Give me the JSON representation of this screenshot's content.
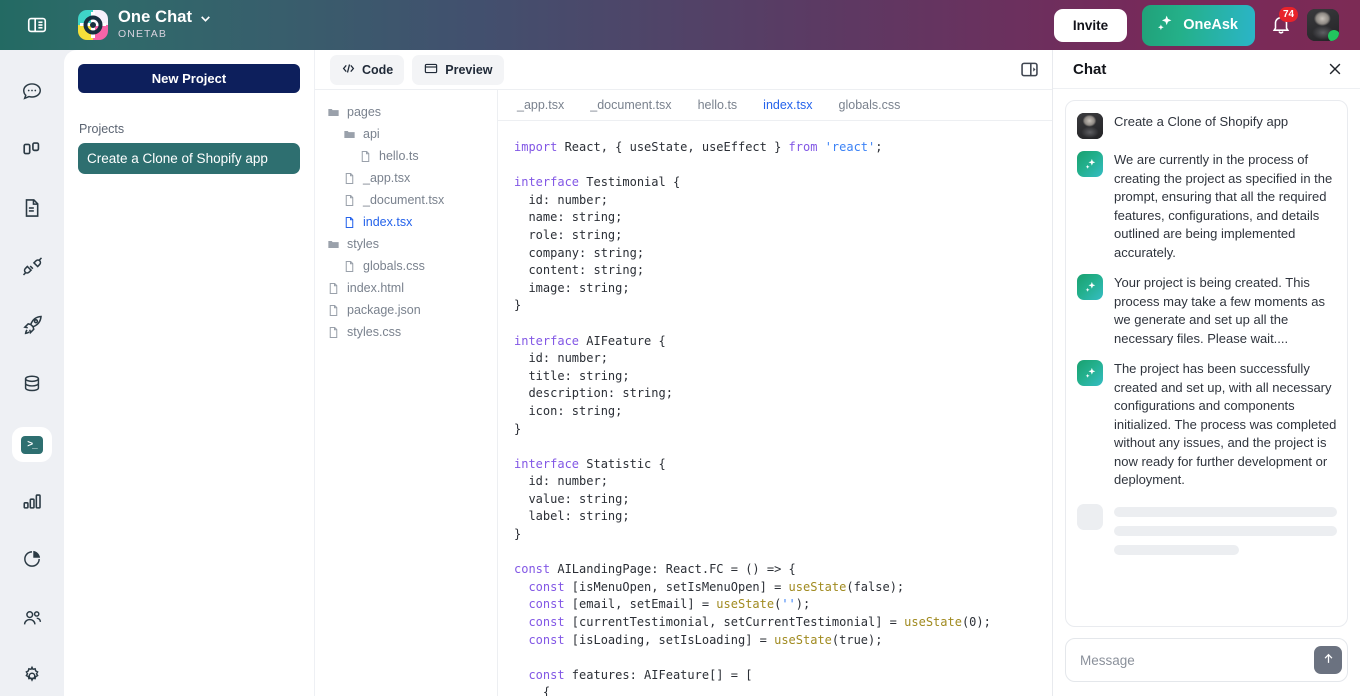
{
  "header": {
    "panel_toggle_icon": "panel-left-icon",
    "logo_icon": "onetab-logo-icon",
    "brand_title": "One Chat",
    "brand_subtitle": "ONETAB",
    "brand_chevron_icon": "chevron-down-icon",
    "invite_label": "Invite",
    "oneask_label": "OneAsk",
    "oneask_icon": "sparkles-icon",
    "bell_icon": "bell-icon",
    "notification_count": "74",
    "avatar_icon": "user-avatar",
    "gradient_start": "#236a63",
    "gradient_mid": "#4a4066",
    "gradient_end": "#7c2b55",
    "accent_teal": "#2e6f70",
    "badge_color": "#e8232b",
    "online_color": "#22c55e"
  },
  "rail": {
    "items": [
      {
        "name": "chat",
        "icon": "chat-bubble-icon",
        "active": false
      },
      {
        "name": "layout",
        "icon": "columns-layout-icon",
        "active": false
      },
      {
        "name": "documents",
        "icon": "document-icon",
        "active": false
      },
      {
        "name": "integrations",
        "icon": "plug-connector-icon",
        "active": false
      },
      {
        "name": "deploy",
        "icon": "rocket-icon",
        "active": false
      },
      {
        "name": "database",
        "icon": "database-icon",
        "active": false
      },
      {
        "name": "terminal",
        "icon": "terminal-icon",
        "active": true
      },
      {
        "name": "analytics",
        "icon": "bar-chart-icon",
        "active": false
      },
      {
        "name": "reports",
        "icon": "pie-chart-icon",
        "active": false
      },
      {
        "name": "team",
        "icon": "users-icon",
        "active": false
      },
      {
        "name": "settings",
        "icon": "gear-icon",
        "active": false
      }
    ]
  },
  "projects": {
    "new_project_label": "New Project",
    "section_label": "Projects",
    "items": [
      {
        "label": "Create a Clone of Shopify app",
        "selected": true
      }
    ]
  },
  "editor": {
    "toolbar": {
      "code_label": "Code",
      "code_icon": "code-brackets-icon",
      "preview_label": "Preview",
      "preview_icon": "window-preview-icon",
      "panel_toggle_icon": "panel-right-icon"
    },
    "filetree": [
      {
        "label": "pages",
        "type": "folder",
        "depth": 0,
        "selected": false
      },
      {
        "label": "api",
        "type": "folder",
        "depth": 1,
        "selected": false
      },
      {
        "label": "hello.ts",
        "type": "file",
        "depth": 2,
        "selected": false
      },
      {
        "label": "_app.tsx",
        "type": "file",
        "depth": 1,
        "selected": false
      },
      {
        "label": "_document.tsx",
        "type": "file",
        "depth": 1,
        "selected": false
      },
      {
        "label": "index.tsx",
        "type": "file",
        "depth": 1,
        "selected": true
      },
      {
        "label": "styles",
        "type": "folder",
        "depth": 0,
        "selected": false
      },
      {
        "label": "globals.css",
        "type": "file",
        "depth": 1,
        "selected": false
      },
      {
        "label": "index.html",
        "type": "file",
        "depth": 0,
        "selected": false
      },
      {
        "label": "package.json",
        "type": "file",
        "depth": 0,
        "selected": false
      },
      {
        "label": "styles.css",
        "type": "file",
        "depth": 0,
        "selected": false
      }
    ],
    "tabs": [
      {
        "label": "_app.tsx",
        "active": false
      },
      {
        "label": "_document.tsx",
        "active": false
      },
      {
        "label": "hello.ts",
        "active": false
      },
      {
        "label": "index.tsx",
        "active": true
      },
      {
        "label": "globals.css",
        "active": false
      }
    ],
    "code_lines": [
      [
        {
          "t": "import",
          "c": "kw"
        },
        {
          "t": " React, { useState, useEffect } ",
          "c": "plain"
        },
        {
          "t": "from",
          "c": "kw"
        },
        {
          "t": " ",
          "c": "plain"
        },
        {
          "t": "'react'",
          "c": "str"
        },
        {
          "t": ";",
          "c": "plain"
        }
      ],
      [],
      [
        {
          "t": "interface",
          "c": "kw"
        },
        {
          "t": " Testimonial {",
          "c": "plain"
        }
      ],
      [
        {
          "t": "  id: number;",
          "c": "plain"
        }
      ],
      [
        {
          "t": "  name: string;",
          "c": "plain"
        }
      ],
      [
        {
          "t": "  role: string;",
          "c": "plain"
        }
      ],
      [
        {
          "t": "  company: string;",
          "c": "plain"
        }
      ],
      [
        {
          "t": "  content: string;",
          "c": "plain"
        }
      ],
      [
        {
          "t": "  image: string;",
          "c": "plain"
        }
      ],
      [
        {
          "t": "}",
          "c": "plain"
        }
      ],
      [],
      [
        {
          "t": "interface",
          "c": "kw"
        },
        {
          "t": " AIFeature {",
          "c": "plain"
        }
      ],
      [
        {
          "t": "  id: number;",
          "c": "plain"
        }
      ],
      [
        {
          "t": "  title: string;",
          "c": "plain"
        }
      ],
      [
        {
          "t": "  description: string;",
          "c": "plain"
        }
      ],
      [
        {
          "t": "  icon: string;",
          "c": "plain"
        }
      ],
      [
        {
          "t": "}",
          "c": "plain"
        }
      ],
      [],
      [
        {
          "t": "interface",
          "c": "kw"
        },
        {
          "t": " Statistic {",
          "c": "plain"
        }
      ],
      [
        {
          "t": "  id: number;",
          "c": "plain"
        }
      ],
      [
        {
          "t": "  value: string;",
          "c": "plain"
        }
      ],
      [
        {
          "t": "  label: string;",
          "c": "plain"
        }
      ],
      [
        {
          "t": "}",
          "c": "plain"
        }
      ],
      [],
      [
        {
          "t": "const",
          "c": "kw"
        },
        {
          "t": " AILandingPage: React.FC = () => {",
          "c": "plain"
        }
      ],
      [
        {
          "t": "  ",
          "c": "plain"
        },
        {
          "t": "const",
          "c": "kw"
        },
        {
          "t": " [isMenuOpen, setIsMenuOpen] = ",
          "c": "plain"
        },
        {
          "t": "useState",
          "c": "fn"
        },
        {
          "t": "(false);",
          "c": "plain"
        }
      ],
      [
        {
          "t": "  ",
          "c": "plain"
        },
        {
          "t": "const",
          "c": "kw"
        },
        {
          "t": " [email, setEmail] = ",
          "c": "plain"
        },
        {
          "t": "useState",
          "c": "fn"
        },
        {
          "t": "(",
          "c": "plain"
        },
        {
          "t": "''",
          "c": "str"
        },
        {
          "t": ");",
          "c": "plain"
        }
      ],
      [
        {
          "t": "  ",
          "c": "plain"
        },
        {
          "t": "const",
          "c": "kw"
        },
        {
          "t": " [currentTestimonial, setCurrentTestimonial] = ",
          "c": "plain"
        },
        {
          "t": "useState",
          "c": "fn"
        },
        {
          "t": "(0);",
          "c": "plain"
        }
      ],
      [
        {
          "t": "  ",
          "c": "plain"
        },
        {
          "t": "const",
          "c": "kw"
        },
        {
          "t": " [isLoading, setIsLoading] = ",
          "c": "plain"
        },
        {
          "t": "useState",
          "c": "fn"
        },
        {
          "t": "(true);",
          "c": "plain"
        }
      ],
      [],
      [
        {
          "t": "  ",
          "c": "plain"
        },
        {
          "t": "const",
          "c": "kw"
        },
        {
          "t": " features: AIFeature[] = [",
          "c": "plain"
        }
      ],
      [
        {
          "t": "    {",
          "c": "plain"
        }
      ]
    ]
  },
  "chat": {
    "title": "Chat",
    "close_icon": "close-icon",
    "messages": [
      {
        "role": "user",
        "avatar_icon": "user-avatar",
        "text": "Create a Clone of Shopify app"
      },
      {
        "role": "ai",
        "avatar_icon": "sparkles-icon",
        "text": "We are currently in the process of creating the project as specified in the prompt, ensuring that all the required features, configurations, and details outlined are being implemented accurately."
      },
      {
        "role": "ai",
        "avatar_icon": "sparkles-icon",
        "text": "Your project is being created. This process may take a few moments as we generate and set up all the necessary files. Please wait...."
      },
      {
        "role": "ai",
        "avatar_icon": "sparkles-icon",
        "text": "The project has been successfully created and set up, with all necessary configurations and components initialized. The process was completed without any issues, and the project is now ready for further development or deployment."
      }
    ],
    "loading_skeleton": true,
    "input_placeholder": "Message",
    "input_value": "",
    "send_icon": "arrow-up-icon"
  }
}
